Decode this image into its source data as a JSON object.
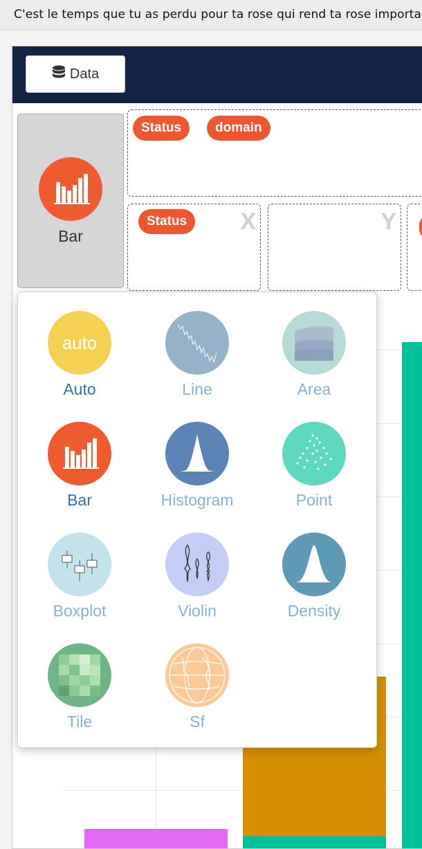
{
  "top_bar": {
    "quote": "C'est le temps que tu as perdu pour ta rose qui rend ta rose importante."
  },
  "navbar": {
    "data_button_label": "Data"
  },
  "geom_selector": {
    "current": "Bar"
  },
  "dropzones": {
    "group": {
      "pills": [
        "Status",
        "domain"
      ]
    },
    "x": {
      "letter": "X",
      "pills": [
        "Status"
      ]
    },
    "y": {
      "letter": "Y",
      "pills": []
    }
  },
  "geom_menu": {
    "items": [
      {
        "label": "Auto",
        "icon": "auto-icon",
        "color": "#f5d152",
        "enabled": true
      },
      {
        "label": "Line",
        "icon": "line-chart-icon",
        "color": "#94b3c9",
        "enabled": false
      },
      {
        "label": "Area",
        "icon": "area-chart-icon",
        "color": "#b6dbd7",
        "enabled": false
      },
      {
        "label": "Bar",
        "icon": "bar-chart-icon",
        "color": "#ef5a2f",
        "enabled": true
      },
      {
        "label": "Histogram",
        "icon": "histogram-icon",
        "color": "#5b83b6",
        "enabled": false
      },
      {
        "label": "Point",
        "icon": "scatter-icon",
        "color": "#5ed8bf",
        "enabled": false
      },
      {
        "label": "Boxplot",
        "icon": "boxplot-icon",
        "color": "#c3e3ec",
        "enabled": false
      },
      {
        "label": "Violin",
        "icon": "violin-icon",
        "color": "#c3cdf6",
        "enabled": false
      },
      {
        "label": "Density",
        "icon": "density-icon",
        "color": "#5c9ab6",
        "enabled": false
      },
      {
        "label": "Tile",
        "icon": "tile-icon",
        "color": "#6db486",
        "enabled": false
      },
      {
        "label": "Sf",
        "icon": "globe-icon",
        "color": "#fbc995",
        "enabled": false
      }
    ]
  },
  "background_chart": {
    "bar_colors": [
      "#e06bf1",
      "#d69102",
      "#00c19a"
    ]
  },
  "colors": {
    "navbar": "#132447",
    "pill": "#ee5630",
    "active_label": "#2e73ab",
    "muted_label": "#86b2d1"
  }
}
